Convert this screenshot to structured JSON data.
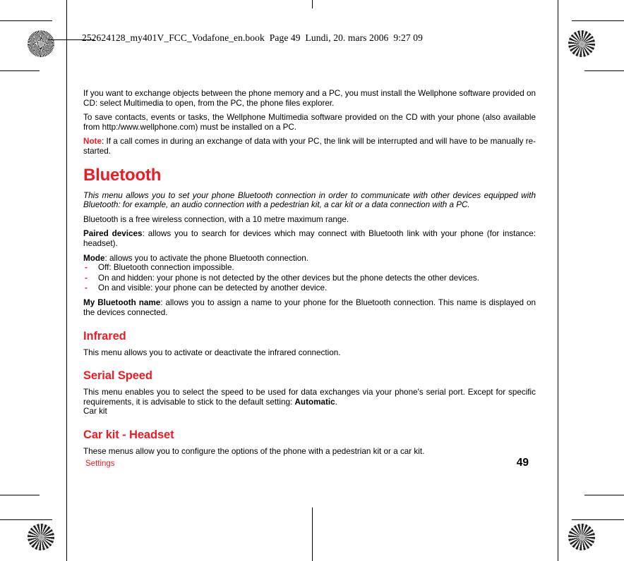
{
  "page": {
    "slug": "252624128_my401V_FCC_Vodafone_en.book  Page 49  Lundi, 20. mars 2006  9:27 09",
    "accent_color": "#ED1C24",
    "text_color": "#000000",
    "background_color": "#FFFFFF"
  },
  "content": {
    "intro": {
      "paragraph_1": "If you want to exchange objects between the phone memory and a PC, you must install the Wellphone software provided on CD: select Multimedia to open, from the PC, the phone files explorer.",
      "paragraph_2": "To save contacts, events or tasks, the Wellphone Multimedia software provided on the CD with your phone (also available from http:/www.wellphone.com) must be installed on a PC.",
      "note_label": "Note",
      "note_text": ": If a call comes in during an exchange of data with your PC, the link will be interrupted and will have to be manually re-started."
    },
    "bluetooth": {
      "heading": "Bluetooth",
      "intro_italic": "This menu allows you to set your phone Bluetooth connection in order to communicate with other devices equipped with Bluetooth: for example, an audio connection with a pedestrian kit, a car kit or a data connection with a PC.",
      "paragraph_1": "Bluetooth is a free wireless connection, with a 10 metre maximum range.",
      "paired_devices_label": "Paired devices",
      "paired_devices_text": ": allows you to search for devices which may connect with Bluetooth link with your phone (for instance: headset).",
      "mode_label": "Mode",
      "mode_text": ": allows you to activate the phone Bluetooth connection.",
      "mode_options": [
        "Off: Bluetooth connection impossible.",
        "On and hidden: your phone is not detected by the other devices but the phone detects the other devices.",
        "On and visible: your phone can be detected by another device."
      ],
      "dash_bullet": "-",
      "my_name_label": "My Bluetooth name",
      "my_name_text": ": allows you to assign a name to your phone for the Bluetooth connection. This name is displayed on the devices connected."
    },
    "infrared": {
      "heading": "Infrared",
      "paragraph_1": "This menu allows you to activate or deactivate the infrared connection."
    },
    "serial_speed": {
      "heading": "Serial Speed",
      "paragraph_1_before": "This menu enables you to select the speed to be used for data exchanges via your phone's serial port. Except for specific requirements, it is advisable to stick to the default setting: ",
      "paragraph_1_bold": "Automatic",
      "paragraph_1_after": ".",
      "paragraph_2": "Car kit"
    },
    "car_kit": {
      "heading": "Car kit - Headset",
      "paragraph_1": "These menus allow you to configure the options of the phone with a pedestrian kit or a car kit."
    }
  },
  "footer": {
    "running_head": "Settings",
    "page_number": "49"
  }
}
